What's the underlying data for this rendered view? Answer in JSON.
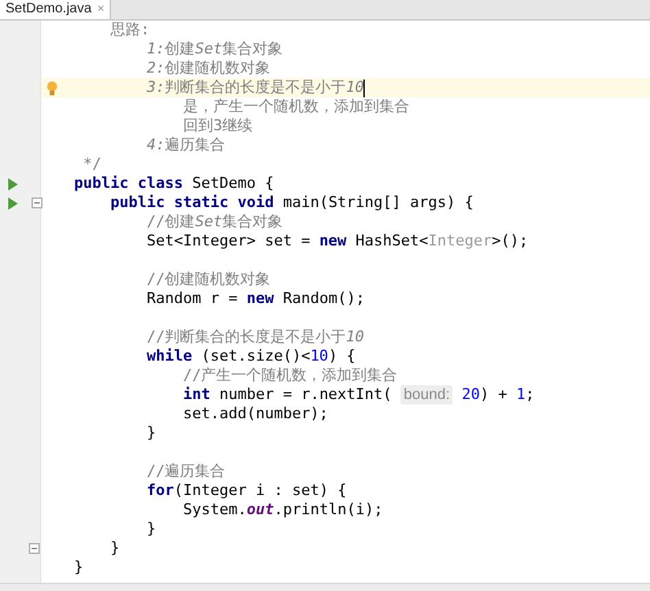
{
  "tab": {
    "title": "SetDemo.java",
    "close": "×",
    "selected": true
  },
  "lines": [
    {
      "kind": "code",
      "tokens": [
        {
          "text": "    思路:",
          "kind": "comment"
        }
      ]
    },
    {
      "kind": "code",
      "tokens": [
        {
          "text": "        1:",
          "kind": "comment-em"
        },
        {
          "text": "创建",
          "kind": "comment"
        },
        {
          "text": "Set",
          "kind": "comment-em"
        },
        {
          "text": "集合对象",
          "kind": "comment"
        }
      ]
    },
    {
      "kind": "code",
      "tokens": [
        {
          "text": "        2:",
          "kind": "comment-em"
        },
        {
          "text": "创建随机数对象",
          "kind": "comment"
        }
      ]
    },
    {
      "kind": "code",
      "highlighted": true,
      "caret": true,
      "bulb_marker": true,
      "tokens": [
        {
          "text": "        3:",
          "kind": "comment-em"
        },
        {
          "text": "判断集合的长度是不是小于",
          "kind": "comment"
        },
        {
          "text": "10",
          "kind": "comment-em"
        }
      ]
    },
    {
      "kind": "code",
      "tokens": [
        {
          "text": "            是，产生一个随机数，添加到集合",
          "kind": "comment"
        }
      ]
    },
    {
      "kind": "code",
      "tokens": [
        {
          "text": "            回到3继续",
          "kind": "comment"
        }
      ]
    },
    {
      "kind": "code",
      "tokens": [
        {
          "text": "        4:",
          "kind": "comment-em"
        },
        {
          "text": "遍历集合",
          "kind": "comment"
        }
      ]
    },
    {
      "kind": "code",
      "tokens": [
        {
          "text": " */",
          "kind": "comment"
        }
      ]
    },
    {
      "kind": "code",
      "run_marker": true,
      "tokens": [
        {
          "text": "public class",
          "kind": "keyword"
        },
        {
          "text": " SetDemo {",
          "kind": "plain"
        }
      ]
    },
    {
      "kind": "code",
      "run_marker": true,
      "fold_marker": true,
      "tokens": [
        {
          "text": "    public static void",
          "kind": "keyword"
        },
        {
          "text": " main(String[] args) {",
          "kind": "plain"
        }
      ]
    },
    {
      "kind": "code",
      "tokens": [
        {
          "text": "        //创建",
          "kind": "comment"
        },
        {
          "text": "Set",
          "kind": "comment-em"
        },
        {
          "text": "集合对象",
          "kind": "comment"
        }
      ]
    },
    {
      "kind": "code",
      "tokens": [
        {
          "text": "        Set<Integer> set = ",
          "kind": "plain"
        },
        {
          "text": "new",
          "kind": "keyword"
        },
        {
          "text": " HashSet<",
          "kind": "plain"
        },
        {
          "text": "Integer",
          "kind": "muted"
        },
        {
          "text": ">();",
          "kind": "plain"
        }
      ]
    },
    {
      "kind": "blank"
    },
    {
      "kind": "code",
      "tokens": [
        {
          "text": "        //创建随机数对象",
          "kind": "comment"
        }
      ]
    },
    {
      "kind": "code",
      "tokens": [
        {
          "text": "        Random r = ",
          "kind": "plain"
        },
        {
          "text": "new",
          "kind": "keyword"
        },
        {
          "text": " Random();",
          "kind": "plain"
        }
      ]
    },
    {
      "kind": "blank"
    },
    {
      "kind": "code",
      "tokens": [
        {
          "text": "        //判断集合的长度是不是小于",
          "kind": "comment"
        },
        {
          "text": "10",
          "kind": "comment-em"
        }
      ]
    },
    {
      "kind": "code",
      "tokens": [
        {
          "text": "        while",
          "kind": "keyword"
        },
        {
          "text": " (set.size()<",
          "kind": "plain"
        },
        {
          "text": "10",
          "kind": "number"
        },
        {
          "text": ") {",
          "kind": "plain"
        }
      ]
    },
    {
      "kind": "code",
      "tokens": [
        {
          "text": "            //产生一个随机数，添加到集合",
          "kind": "comment"
        }
      ]
    },
    {
      "kind": "code",
      "tokens": [
        {
          "text": "            int",
          "kind": "keyword"
        },
        {
          "text": " number = r.nextInt( ",
          "kind": "plain"
        },
        {
          "text": "bound:",
          "kind": "hint"
        },
        {
          "text": " 20",
          "kind": "number"
        },
        {
          "text": ") + ",
          "kind": "plain"
        },
        {
          "text": "1",
          "kind": "number"
        },
        {
          "text": ";",
          "kind": "plain"
        }
      ]
    },
    {
      "kind": "code",
      "tokens": [
        {
          "text": "            set.add(number);",
          "kind": "plain"
        }
      ]
    },
    {
      "kind": "code",
      "tokens": [
        {
          "text": "        }",
          "kind": "plain"
        }
      ]
    },
    {
      "kind": "blank"
    },
    {
      "kind": "code",
      "tokens": [
        {
          "text": "        //遍历集合",
          "kind": "comment"
        }
      ]
    },
    {
      "kind": "code",
      "tokens": [
        {
          "text": "        for",
          "kind": "keyword"
        },
        {
          "text": "(Integer i : set) {",
          "kind": "plain"
        }
      ]
    },
    {
      "kind": "code",
      "tokens": [
        {
          "text": "            System.",
          "kind": "plain"
        },
        {
          "text": "out",
          "kind": "static"
        },
        {
          "text": ".println(i);",
          "kind": "plain"
        }
      ]
    },
    {
      "kind": "code",
      "tokens": [
        {
          "text": "        }",
          "kind": "plain"
        }
      ]
    },
    {
      "kind": "code",
      "fold_marker": true,
      "tokens": [
        {
          "text": "    }",
          "kind": "plain"
        }
      ]
    },
    {
      "kind": "code",
      "tokens": [
        {
          "text": "}",
          "kind": "plain"
        }
      ]
    }
  ]
}
